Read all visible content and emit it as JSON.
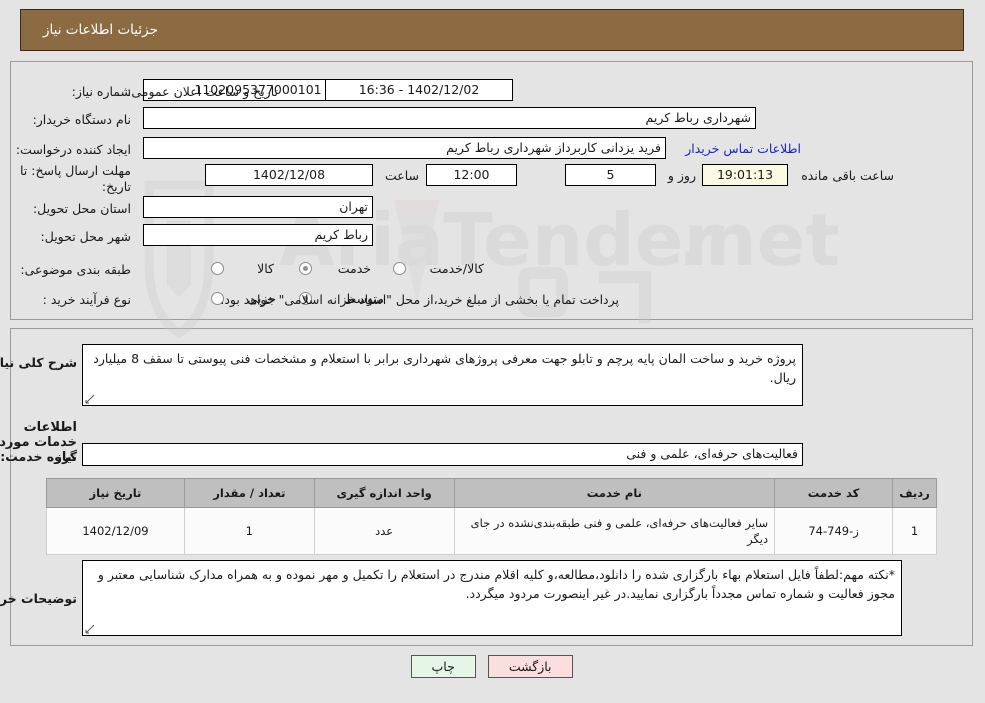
{
  "window": {
    "title": "جزئیات اطلاعات نیاز"
  },
  "top_form": {
    "need_number_label": "شماره نیاز:",
    "need_number_value": "1102095377000101",
    "announce_label": "تاریخ و ساعت اعلان عمومی:",
    "announce_value": "1402/12/02 - 16:36",
    "buyer_org_label": "نام دستگاه خریدار:",
    "buyer_org_value": "شهرداری رباط کریم",
    "requester_label": "ایجاد کننده درخواست:",
    "requester_value": "فرید یزدانی کاربرداز شهرداری رباط کریم",
    "contact_link": "اطلاعات تماس خریدار",
    "deadline_label": "مهلت ارسال پاسخ: تا تاریخ:",
    "deadline_date": "1402/12/08",
    "hour_label": "ساعت",
    "hour_value": "12:00",
    "days_value": "5",
    "days_label": "روز و",
    "timer_value": "19:01:13",
    "timer_label": "ساعت باقی مانده",
    "province_label": "استان محل تحویل:",
    "province_value": "تهران",
    "city_label": "شهر محل تحویل:",
    "city_value": "رباط کریم",
    "category_label": "طبقه بندی موضوعی:",
    "category_options": [
      {
        "label": "کالا",
        "selected": false
      },
      {
        "label": "خدمت",
        "selected": true
      },
      {
        "label": "کالا/خدمت",
        "selected": false
      }
    ],
    "process_label": "نوع فرآیند خرید :",
    "process_options": [
      {
        "label": "جزیی",
        "selected": false
      },
      {
        "label": "متوسط",
        "selected": true
      }
    ],
    "treasury_note": "پرداخت تمام یا بخشی از مبلغ خرید،از محل \"اسناد خزانه اسلامی\" خواهد بود."
  },
  "description": {
    "label": "شرح کلی نیاز:",
    "text": "پروژه خرید و ساخت المان پایه پرچم و تابلو جهت معرفی پروژهای شهرداری برابر با استعلام و مشخصات فنی پیوستی تا سقف 8 میلیارد ریال."
  },
  "services_section": {
    "heading": "اطلاعات خدمات مورد نیاز",
    "group_label": "گروه خدمت:",
    "group_value": "فعالیت‌های حرفه‌ای، علمی و فنی"
  },
  "items_table": {
    "headers": [
      "ردیف",
      "کد خدمت",
      "نام خدمت",
      "واحد اندازه گیری",
      "تعداد / مقدار",
      "تاریخ نیاز"
    ],
    "rows": [
      {
        "row": "1",
        "code": "ز-749-74",
        "name": "سایر فعالیت‌های حرفه‌ای، علمی و فنی طبقه‌بندی‌نشده در جای دیگر",
        "unit": "عدد",
        "qty": "1",
        "date": "1402/12/09"
      }
    ]
  },
  "buyer_notes": {
    "label": "توضیحات خریدار:",
    "text": "*نکته مهم:لطفاً فایل استعلام بهاء بارگزاری شده را دانلود،مطالعه،و کلیه اقلام مندرج در استعلام را تکمیل و مهر نموده و به همراه مدارک شناسایی معتبر و مجوز فعالیت و شماره تماس مجدداً بارگزاری نمایید.در غیر اینصورت مردود میگردد."
  },
  "buttons": {
    "print": "چاپ",
    "back": "بازگشت"
  },
  "colors": {
    "titlebar_bg": "#8c6b43",
    "page_bg": "#e4e4e4",
    "link": "#1a22cc",
    "timer_bg": "#fbfbe3",
    "table_header_bg": "#bfbfbf",
    "print_btn_bg": "#e6f6e6",
    "back_btn_bg": "#fbdede"
  },
  "watermark": {
    "text": "AriaTender.net"
  }
}
